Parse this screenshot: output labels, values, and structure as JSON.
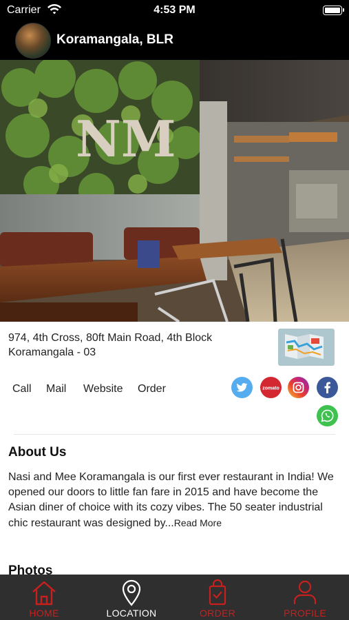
{
  "status_bar": {
    "carrier": "Carrier",
    "time": "4:53 PM"
  },
  "header": {
    "title": "Koramangala, BLR"
  },
  "address": {
    "line1": "974, 4th Cross, 80ft Main Road, 4th Block",
    "line2": "Koramangala - 03"
  },
  "actions": {
    "call": "Call",
    "mail": "Mail",
    "website": "Website",
    "order": "Order"
  },
  "social": {
    "zomato_label": "zomato"
  },
  "about": {
    "title": "About Us",
    "body": "Nasi and Mee Koramangala is our first ever restaurant in India! We opened our doors to little fan fare in 2015 and have become the Asian diner of choice with its cozy vibes. The 50 seater industrial chic restaurant was designed by...",
    "read_more": "Read More"
  },
  "photos": {
    "title": "Photos"
  },
  "tabs": [
    {
      "label": "HOME"
    },
    {
      "label": "LOCATION"
    },
    {
      "label": "ORDER"
    },
    {
      "label": "PROFILE"
    }
  ],
  "colors": {
    "accent_red": "#c8201e",
    "tabbar_bg": "#2f2f2f",
    "header_bg": "#000000"
  }
}
